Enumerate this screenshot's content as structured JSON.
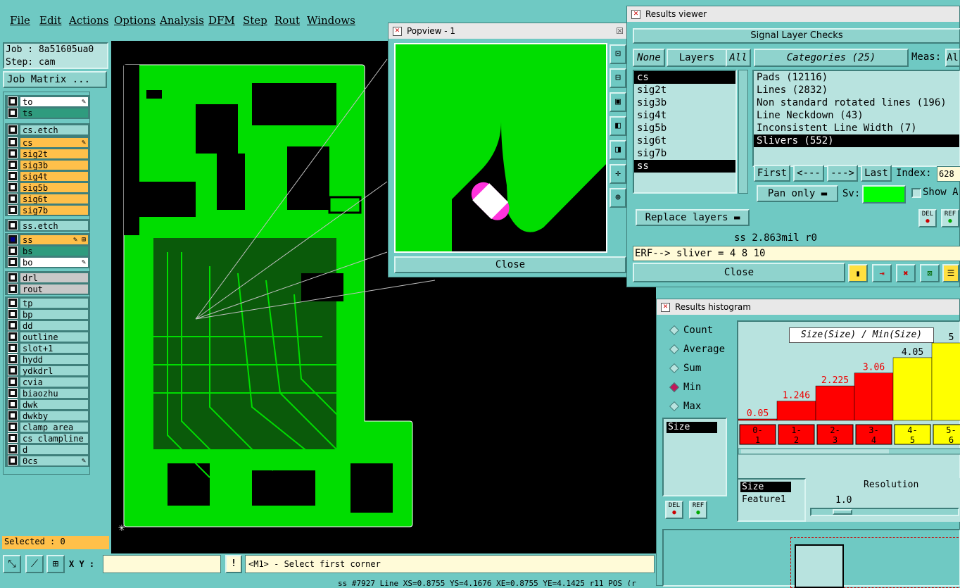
{
  "menubar": [
    "File",
    "Edit",
    "Actions",
    "Options",
    "Analysis",
    "DFM",
    "Step",
    "Rout",
    "Windows"
  ],
  "job": {
    "job_line": "Job : 8a51605ua0",
    "step_line": "Step: cam",
    "matrix_button": "Job Matrix ..."
  },
  "layer_groups": [
    [
      {
        "name": "to",
        "style": "w",
        "mark": "✎"
      },
      {
        "name": "ts",
        "style": "t"
      }
    ],
    [
      {
        "name": "cs.etch",
        "style": "tl"
      }
    ],
    [
      {
        "name": "cs",
        "style": "o",
        "mark": "✎"
      },
      {
        "name": "sig2t",
        "style": "o"
      },
      {
        "name": "sig3b",
        "style": "o"
      },
      {
        "name": "sig4t",
        "style": "o"
      },
      {
        "name": "sig5b",
        "style": "o"
      },
      {
        "name": "sig6t",
        "style": "o"
      },
      {
        "name": "sig7b",
        "style": "o"
      }
    ],
    [
      {
        "name": "ss.etch",
        "style": "tl"
      }
    ],
    [
      {
        "name": "ss",
        "style": "o",
        "mark": "✎ ⊞",
        "active": true
      },
      {
        "name": "bs",
        "style": "t"
      },
      {
        "name": "bo",
        "style": "w",
        "mark": "✎"
      }
    ],
    [
      {
        "name": "drl",
        "style": "g"
      },
      {
        "name": "rout",
        "style": "g"
      }
    ],
    [
      {
        "name": "tp",
        "style": "tl"
      },
      {
        "name": "bp",
        "style": "tl"
      },
      {
        "name": "dd",
        "style": "tl"
      },
      {
        "name": "outline",
        "style": "tl"
      },
      {
        "name": "slot+1",
        "style": "tl"
      },
      {
        "name": "hydd",
        "style": "tl"
      },
      {
        "name": "ydkdrl",
        "style": "tl"
      },
      {
        "name": "cvia",
        "style": "tl"
      },
      {
        "name": "biaozhu",
        "style": "tl"
      },
      {
        "name": "dwk",
        "style": "tl"
      },
      {
        "name": "dwkby",
        "style": "tl"
      },
      {
        "name": "clamp_area",
        "style": "tl"
      },
      {
        "name": "cs_clampline",
        "style": "tl"
      },
      {
        "name": "d",
        "style": "tl"
      },
      {
        "name": "0cs",
        "style": "tl",
        "mark": "✎"
      }
    ]
  ],
  "selected": "Selected : 0",
  "bottom": {
    "xy_label": "X Y :",
    "xy_value": "",
    "warn": "!",
    "prompt": "<M1> - Select first corner",
    "status": "ss #7927 Line XS=0.8755 YS=4.1676 XE=0.8755 YE=4.1425 r11 POS (r"
  },
  "popview": {
    "title": "Popview - 1",
    "close": "Close"
  },
  "results_viewer": {
    "title": "Results viewer",
    "header": "Signal Layer Checks",
    "tab_none": "None",
    "tab_layers": "Layers",
    "tab_all": "All",
    "tab_categories": "Categories (25)",
    "meas_label": "Meas:",
    "meas_value": "Al",
    "layers": [
      "cs",
      "sig2t",
      "sig3b",
      "sig4t",
      "sig5b",
      "sig6t",
      "sig7b",
      "ss"
    ],
    "categories": [
      "Pads (12116)",
      "Lines (2832)",
      "Non standard rotated lines (196)",
      "Line Neckdown (43)",
      "Inconsistent Line Width (7)",
      "Slivers (552)"
    ],
    "nav": {
      "first": "First",
      "prev": "<---",
      "next": "--->",
      "last": "Last",
      "index_label": "Index:",
      "index_value": "628"
    },
    "pan": "Pan only",
    "sv_label": "Sv:",
    "show_label": "Show A",
    "del": "DEL",
    "ref": "REF",
    "replace": "Replace layers",
    "ss_line": "ss 2.863mil  r0",
    "erf_line": "ERF--> sliver = 4 8 10",
    "close": "Close"
  },
  "histogram": {
    "title": "Results histogram",
    "options": [
      "Count",
      "Average",
      "Sum",
      "Min",
      "Max"
    ],
    "selected_option": "Min",
    "size_items": [
      "Size"
    ],
    "plot_title": "Size(Size) / Min(Size)",
    "del": "DEL",
    "ref": "REF",
    "res_items": [
      "Size",
      "Feature1"
    ],
    "resolution_label": "Resolution",
    "resolution_value": "1.0"
  },
  "chart_data": {
    "type": "bar",
    "title": "Size(Size) / Min(Size)",
    "categories": [
      "0-1",
      "1-2",
      "2-3",
      "3-4",
      "4-5",
      "5-6"
    ],
    "values": [
      0.05,
      1.246,
      2.225,
      3.06,
      4.05,
      5
    ],
    "value_labels": [
      "0.05",
      "1.246",
      "2.225",
      "3.06",
      "4.05",
      "5"
    ],
    "colors": [
      "#ff0000",
      "#ff0000",
      "#ff0000",
      "#ff0000",
      "#ffff00",
      "#ffff00"
    ],
    "ylim": [
      0,
      6
    ]
  }
}
